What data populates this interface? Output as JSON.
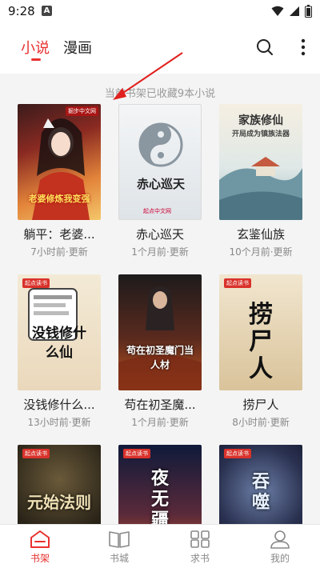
{
  "status": {
    "time": "9:28",
    "notification_badge": "A",
    "icons": [
      "wifi-icon",
      "signal-icon",
      "battery-icon"
    ]
  },
  "header": {
    "tabs": [
      {
        "label": "小说",
        "active": true
      },
      {
        "label": "漫画",
        "active": false
      }
    ],
    "icons": [
      "search-icon",
      "more-icon"
    ]
  },
  "shelf": {
    "notice": "当前书架已收藏9本小说",
    "books": [
      {
        "title": "躺平：老婆...",
        "updated": "7小时前·更新",
        "cover_text": "老婆修炼我变强",
        "cover_badge": "掘步中文网"
      },
      {
        "title": "赤心巡天",
        "updated": "1个月前·更新",
        "cover_text": "赤心巡天",
        "cover_badge": "起点中文网"
      },
      {
        "title": "玄鉴仙族",
        "updated": "10个月前·更新",
        "cover_text": "家族修仙",
        "cover_subtext": "开局成为镇族法器"
      },
      {
        "title": "没钱修什么...",
        "updated": "13小时前·更新",
        "cover_text": "没钱修什么仙",
        "cover_badge": "起点读书"
      },
      {
        "title": "苟在初圣魔...",
        "updated": "1个月前·更新",
        "cover_text": "苟在初圣魔门当人材"
      },
      {
        "title": "捞尸人",
        "updated": "8小时前·更新",
        "cover_text": "捞尸人",
        "cover_badge": "起点读书"
      },
      {
        "title": "",
        "updated": "",
        "cover_text": "元始法则",
        "cover_badge": "起点读书"
      },
      {
        "title": "",
        "updated": "",
        "cover_text": "夜无疆",
        "cover_badge": "起点读书"
      },
      {
        "title": "",
        "updated": "",
        "cover_text": "吞噬",
        "cover_badge": "起点读书"
      }
    ]
  },
  "bottom_nav": [
    {
      "label": "书架",
      "icon": "bookshelf-icon",
      "active": true
    },
    {
      "label": "书城",
      "icon": "book-city-icon",
      "active": false
    },
    {
      "label": "求书",
      "icon": "request-book-icon",
      "active": false
    },
    {
      "label": "我的",
      "icon": "profile-icon",
      "active": false
    }
  ],
  "colors": {
    "accent": "#e8312f",
    "background": "#f4f4f4",
    "muted_text": "#888888"
  }
}
